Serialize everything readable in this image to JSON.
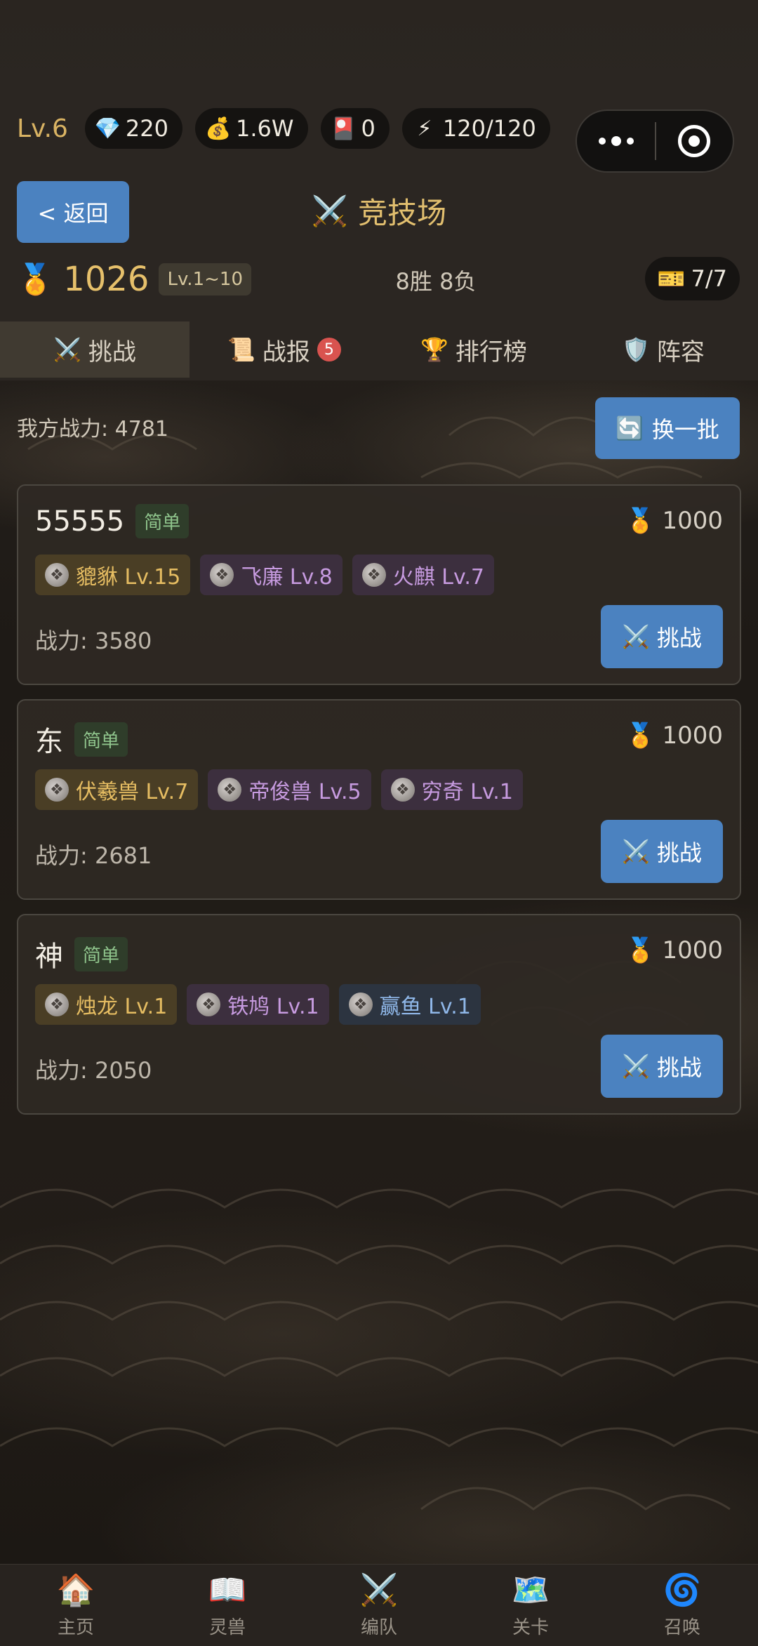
{
  "status": {
    "level": "Lv.6",
    "resources": [
      {
        "icon": "diamond-icon",
        "glyph": "💎",
        "value": "220"
      },
      {
        "icon": "money-bag-icon",
        "glyph": "💰",
        "value": "1.6W"
      },
      {
        "icon": "red-ticket-icon",
        "glyph": "🎴",
        "value": "0"
      },
      {
        "icon": "energy-icon",
        "glyph": "⚡",
        "value": "120/120"
      }
    ]
  },
  "header": {
    "back_label": "< 返回",
    "title": "竞技场",
    "title_icon": "⚔️",
    "score": "1026",
    "range": "Lv.1~10",
    "record": "8胜 8负",
    "tickets": "7/7"
  },
  "tabs": [
    {
      "icon": "⚔️",
      "label": "挑战",
      "active": true
    },
    {
      "icon": "📜",
      "label": "战报",
      "badge": "5"
    },
    {
      "icon": "🏆",
      "label": "排行榜"
    },
    {
      "icon": "🛡️",
      "label": "阵容"
    }
  ],
  "main": {
    "my_power": "我方战力: 4781",
    "refresh_label": "换一批"
  },
  "opponents": [
    {
      "name": "55555",
      "difficulty": "简单",
      "points": "1000",
      "power": "战力: 3580",
      "beasts": [
        {
          "label": "貔貅 Lv.15",
          "rarity": "gold"
        },
        {
          "label": "飞廉 Lv.8",
          "rarity": "purple"
        },
        {
          "label": "火麒 Lv.7",
          "rarity": "purple"
        }
      ]
    },
    {
      "name": "东",
      "difficulty": "简单",
      "points": "1000",
      "power": "战力: 2681",
      "beasts": [
        {
          "label": "伏羲兽 Lv.7",
          "rarity": "gold"
        },
        {
          "label": "帝俊兽 Lv.5",
          "rarity": "purple"
        },
        {
          "label": "穷奇 Lv.1",
          "rarity": "purple"
        }
      ]
    },
    {
      "name": "神",
      "difficulty": "简单",
      "points": "1000",
      "power": "战力: 2050",
      "beasts": [
        {
          "label": "烛龙 Lv.1",
          "rarity": "gold"
        },
        {
          "label": "铁鸠 Lv.1",
          "rarity": "purple"
        },
        {
          "label": "赢鱼 Lv.1",
          "rarity": "blue"
        }
      ]
    }
  ],
  "challenge_label": "挑战",
  "nav": [
    {
      "icon": "home-icon",
      "glyph": "🏠",
      "label": "主页"
    },
    {
      "icon": "book-icon",
      "glyph": "📖",
      "label": "灵兽"
    },
    {
      "icon": "swords-icon",
      "glyph": "⚔️",
      "label": "编队"
    },
    {
      "icon": "map-icon",
      "glyph": "🗺️",
      "label": "关卡"
    },
    {
      "icon": "swirl-icon",
      "glyph": "🌀",
      "label": "召唤"
    }
  ]
}
